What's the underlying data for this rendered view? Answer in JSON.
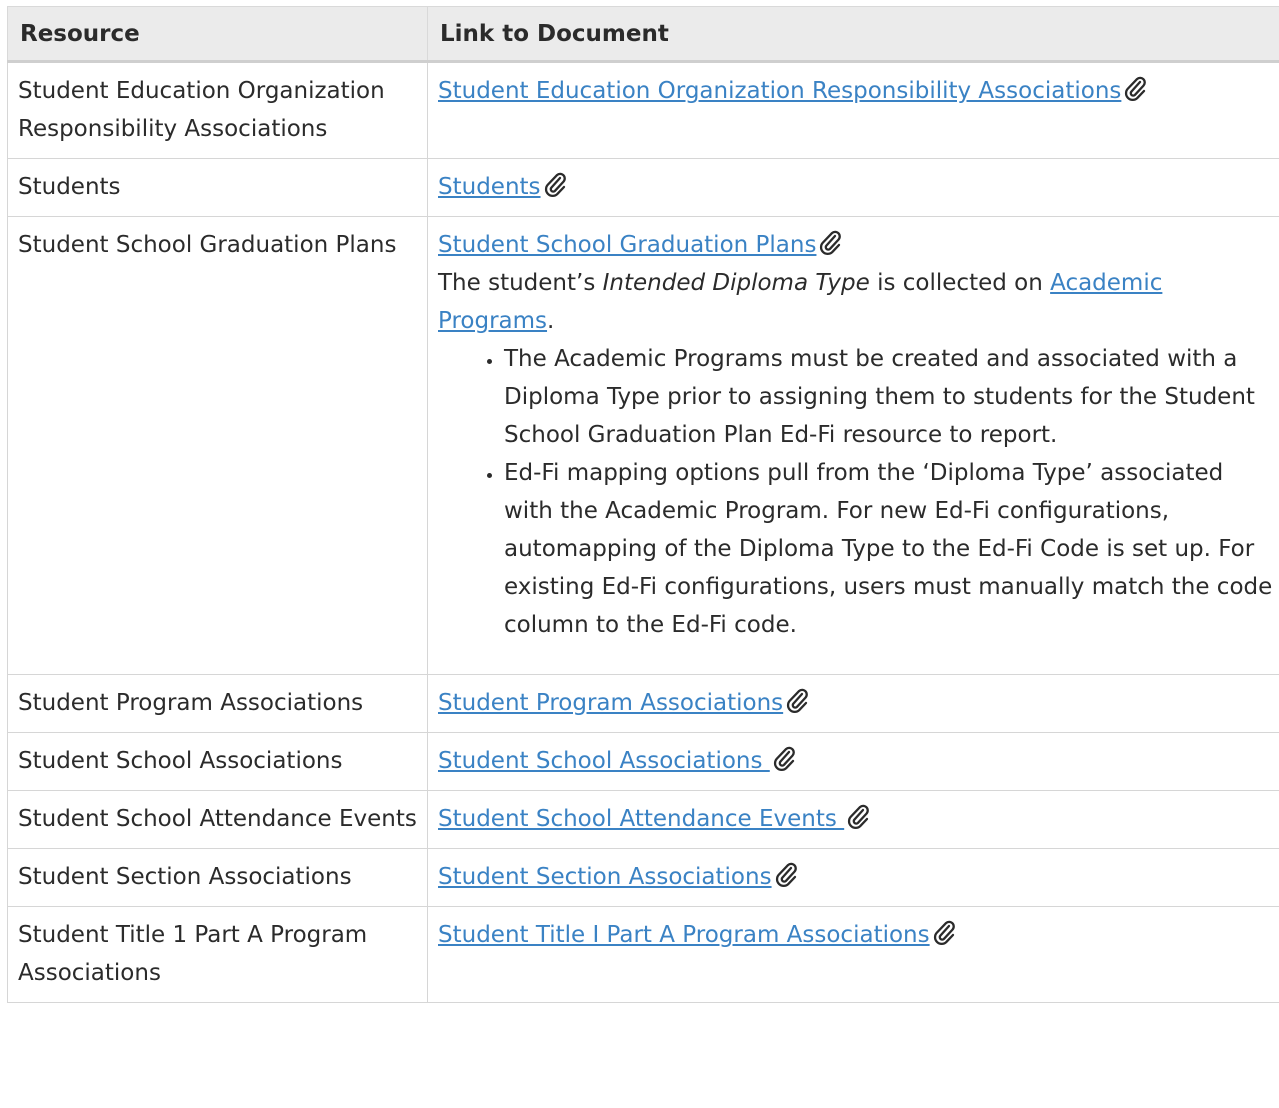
{
  "table": {
    "headers": [
      "Resource",
      "Link to Document"
    ],
    "rows": [
      {
        "resource": "Student Education Organization Responsibility Associations",
        "link": "Student Education Organization Responsibility Associations"
      },
      {
        "resource": "Students",
        "link": "Students"
      },
      {
        "resource": "Student School Graduation Plans",
        "link": "Student School Graduation Plans"
      },
      {
        "resource": "Student Program Associations",
        "link": "Student Program Associations"
      },
      {
        "resource": "Student School Associations",
        "link": "Student School Associations "
      },
      {
        "resource": "Student School Attendance Events",
        "link": "Student School Attendance Events "
      },
      {
        "resource": "Student Section Associations",
        "link": "Student Section Associations"
      },
      {
        "resource": "Student Title 1 Part A Program Associations",
        "link": "Student Title I Part A Program Associations"
      }
    ]
  },
  "graduation_note": {
    "prefix": "The student’s ",
    "italic": "Intended Diploma Type",
    "middle": " is collected on ",
    "link": "Academic Programs",
    "suffix": ".",
    "bullets": [
      "The Academic Programs must be created and associated with a Diploma Type prior to assigning them to students for the Student School Graduation Plan Ed-Fi resource to report.",
      "Ed-Fi mapping options pull from the ‘Diploma Type’ associated with the Academic Program. For new Ed-Fi configurations, automapping of the Diploma Type to the Ed-Fi Code is set up. For existing Ed-Fi configurations, users must manually match the code column to the Ed-Fi code."
    ]
  },
  "icons": {
    "attachment": "paperclip-icon"
  },
  "colors": {
    "link": "#3a82c4",
    "header_bg": "#ebebeb",
    "border": "#d6d6d6"
  }
}
